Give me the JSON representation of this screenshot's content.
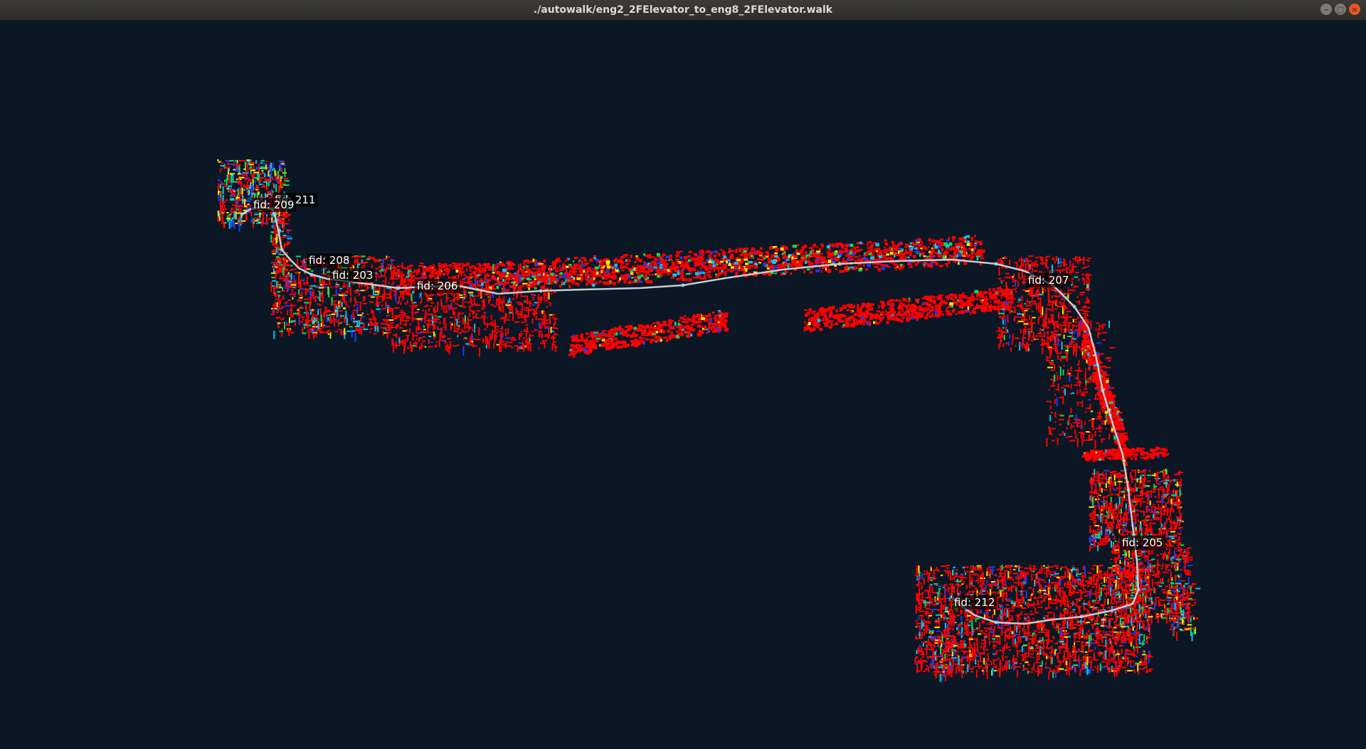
{
  "window": {
    "title": "./autowalk/eng2_2FElevator_to_eng8_2FElevator.walk",
    "controls": {
      "minimize": "–",
      "maximize": "□",
      "close": "×"
    }
  },
  "viewport": {
    "background": "#0b1724",
    "path_color": "#c9ccd2",
    "point_colors": [
      "#ff0000",
      "#00e05a",
      "#00c8ff",
      "#ffe400",
      "#1a3cff"
    ]
  },
  "fiducials": [
    {
      "label": "fid: 211"
    },
    {
      "label": "fid: 209"
    },
    {
      "label": "fid: 208"
    },
    {
      "label": "fid: 203"
    },
    {
      "label": "fid: 206"
    },
    {
      "label": "fid: 207"
    },
    {
      "label": "fid: 205"
    },
    {
      "label": "fid: 212"
    }
  ]
}
